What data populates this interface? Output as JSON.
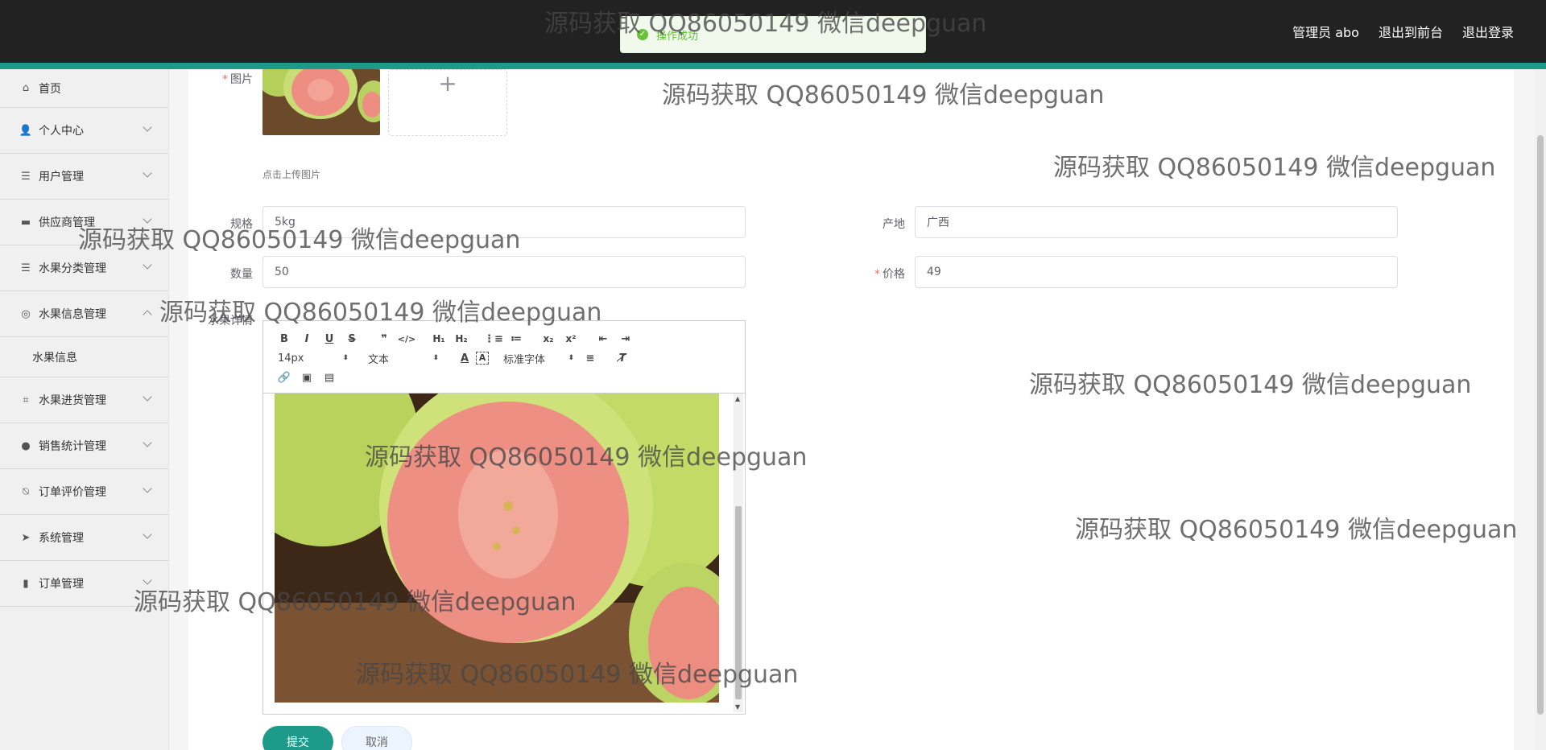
{
  "header": {
    "links": [
      "管理员 abo",
      "退出到前台",
      "退出登录"
    ]
  },
  "toast": {
    "text": "操作成功"
  },
  "sidebar": {
    "items": [
      {
        "label": "首页",
        "icon": "home-icon"
      },
      {
        "label": "个人中心",
        "icon": "user-icon"
      },
      {
        "label": "用户管理",
        "icon": "list-icon"
      },
      {
        "label": "供应商管理",
        "icon": "box-icon"
      },
      {
        "label": "水果分类管理",
        "icon": "list-icon"
      },
      {
        "label": "水果信息管理",
        "icon": "compass-icon",
        "expanded": true
      },
      {
        "label": "水果信息",
        "sub": true
      },
      {
        "label": "水果进货管理",
        "icon": "crop-icon"
      },
      {
        "label": "销售统计管理",
        "icon": "pie-icon"
      },
      {
        "label": "订单评价管理",
        "icon": "bell-off-icon"
      },
      {
        "label": "系统管理",
        "icon": "send-icon"
      },
      {
        "label": "订单管理",
        "icon": "chart-icon"
      }
    ]
  },
  "form": {
    "image_label": "图片",
    "upload_hint": "点击上传图片",
    "spec_label": "规格",
    "spec_value": "5kg",
    "origin_label": "产地",
    "origin_value": "广西",
    "qty_label": "数量",
    "qty_value": "50",
    "price_label": "价格",
    "price_value": "49",
    "detail_label": "水果详情"
  },
  "editor": {
    "font_size": "14px",
    "paragraph": "文本",
    "font_family": "标准字体"
  },
  "buttons": {
    "submit": "提交",
    "cancel": "取消"
  },
  "watermark": "源码获取 QQ86050149 微信deepguan",
  "colors": {
    "accent": "#1d9a8a",
    "topbar": "#222222",
    "required": "#f56c6c"
  }
}
